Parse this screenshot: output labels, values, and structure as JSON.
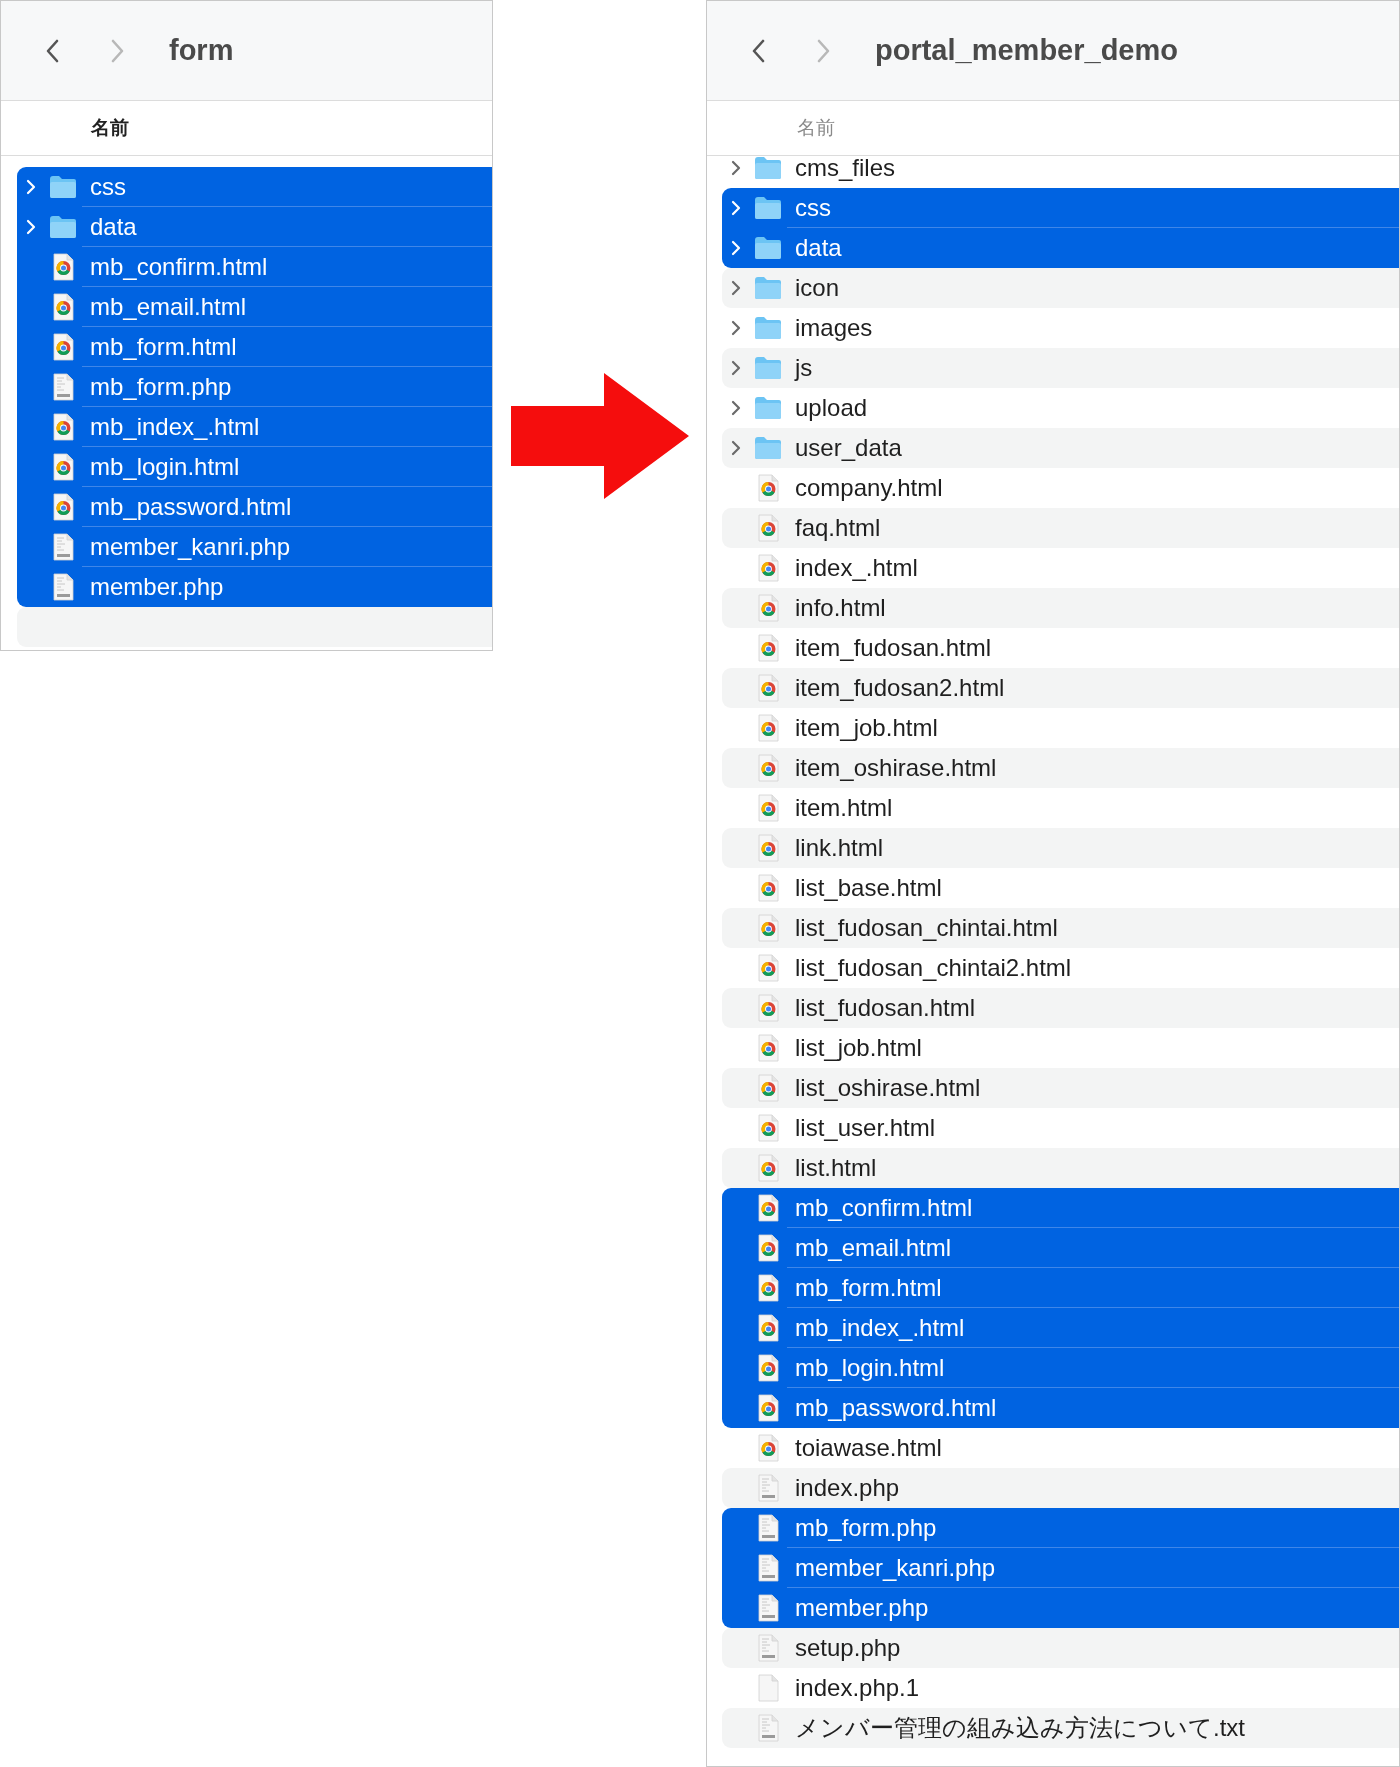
{
  "windows": [
    {
      "title": "form",
      "active": true,
      "nav": [
        {
          "kind": "back",
          "disabled": false
        },
        {
          "kind": "forward",
          "disabled": true
        }
      ],
      "column_header": "名前",
      "items": [
        {
          "name": "css",
          "kind": "folder",
          "selected": true
        },
        {
          "name": "data",
          "kind": "folder",
          "selected": true
        },
        {
          "name": "mb_confirm.html",
          "kind": "html",
          "selected": true
        },
        {
          "name": "mb_email.html",
          "kind": "html",
          "selected": true
        },
        {
          "name": "mb_form.html",
          "kind": "html",
          "selected": true
        },
        {
          "name": "mb_form.php",
          "kind": "php",
          "selected": true
        },
        {
          "name": "mb_index_.html",
          "kind": "html",
          "selected": true
        },
        {
          "name": "mb_login.html",
          "kind": "html",
          "selected": true
        },
        {
          "name": "mb_password.html",
          "kind": "html",
          "selected": true
        },
        {
          "name": "member_kanri.php",
          "kind": "php",
          "selected": true
        },
        {
          "name": "member.php",
          "kind": "php",
          "selected": true
        }
      ]
    },
    {
      "title": "portal_member_demo",
      "active": false,
      "nav": [
        {
          "kind": "back",
          "disabled": false
        },
        {
          "kind": "forward",
          "disabled": true
        }
      ],
      "column_header": "名前",
      "items": [
        {
          "name": "cms_files",
          "kind": "folder",
          "selected": false
        },
        {
          "name": "css",
          "kind": "folder",
          "selected": true
        },
        {
          "name": "data",
          "kind": "folder",
          "selected": true
        },
        {
          "name": "icon",
          "kind": "folder",
          "selected": false
        },
        {
          "name": "images",
          "kind": "folder",
          "selected": false
        },
        {
          "name": "js",
          "kind": "folder",
          "selected": false
        },
        {
          "name": "upload",
          "kind": "folder",
          "selected": false
        },
        {
          "name": "user_data",
          "kind": "folder",
          "selected": false
        },
        {
          "name": "company.html",
          "kind": "html",
          "selected": false
        },
        {
          "name": "faq.html",
          "kind": "html",
          "selected": false
        },
        {
          "name": "index_.html",
          "kind": "html",
          "selected": false
        },
        {
          "name": "info.html",
          "kind": "html",
          "selected": false
        },
        {
          "name": "item_fudosan.html",
          "kind": "html",
          "selected": false
        },
        {
          "name": "item_fudosan2.html",
          "kind": "html",
          "selected": false
        },
        {
          "name": "item_job.html",
          "kind": "html",
          "selected": false
        },
        {
          "name": "item_oshirase.html",
          "kind": "html",
          "selected": false
        },
        {
          "name": "item.html",
          "kind": "html",
          "selected": false
        },
        {
          "name": "link.html",
          "kind": "html",
          "selected": false
        },
        {
          "name": "list_base.html",
          "kind": "html",
          "selected": false
        },
        {
          "name": "list_fudosan_chintai.html",
          "kind": "html",
          "selected": false
        },
        {
          "name": "list_fudosan_chintai2.html",
          "kind": "html",
          "selected": false
        },
        {
          "name": "list_fudosan.html",
          "kind": "html",
          "selected": false
        },
        {
          "name": "list_job.html",
          "kind": "html",
          "selected": false
        },
        {
          "name": "list_oshirase.html",
          "kind": "html",
          "selected": false
        },
        {
          "name": "list_user.html",
          "kind": "html",
          "selected": false
        },
        {
          "name": "list.html",
          "kind": "html",
          "selected": false
        },
        {
          "name": "mb_confirm.html",
          "kind": "html",
          "selected": true
        },
        {
          "name": "mb_email.html",
          "kind": "html",
          "selected": true
        },
        {
          "name": "mb_form.html",
          "kind": "html",
          "selected": true
        },
        {
          "name": "mb_index_.html",
          "kind": "html",
          "selected": true
        },
        {
          "name": "mb_login.html",
          "kind": "html",
          "selected": true
        },
        {
          "name": "mb_password.html",
          "kind": "html",
          "selected": true
        },
        {
          "name": "toiawase.html",
          "kind": "html",
          "selected": false
        },
        {
          "name": "index.php",
          "kind": "php",
          "selected": false
        },
        {
          "name": "mb_form.php",
          "kind": "php",
          "selected": true
        },
        {
          "name": "member_kanri.php",
          "kind": "php",
          "selected": true
        },
        {
          "name": "member.php",
          "kind": "php",
          "selected": true
        },
        {
          "name": "setup.php",
          "kind": "php",
          "selected": false
        },
        {
          "name": "index.php.1",
          "kind": "blank",
          "selected": false
        },
        {
          "name": "メンバー管理の組み込み方法について.txt",
          "kind": "txt",
          "selected": false
        }
      ]
    }
  ]
}
